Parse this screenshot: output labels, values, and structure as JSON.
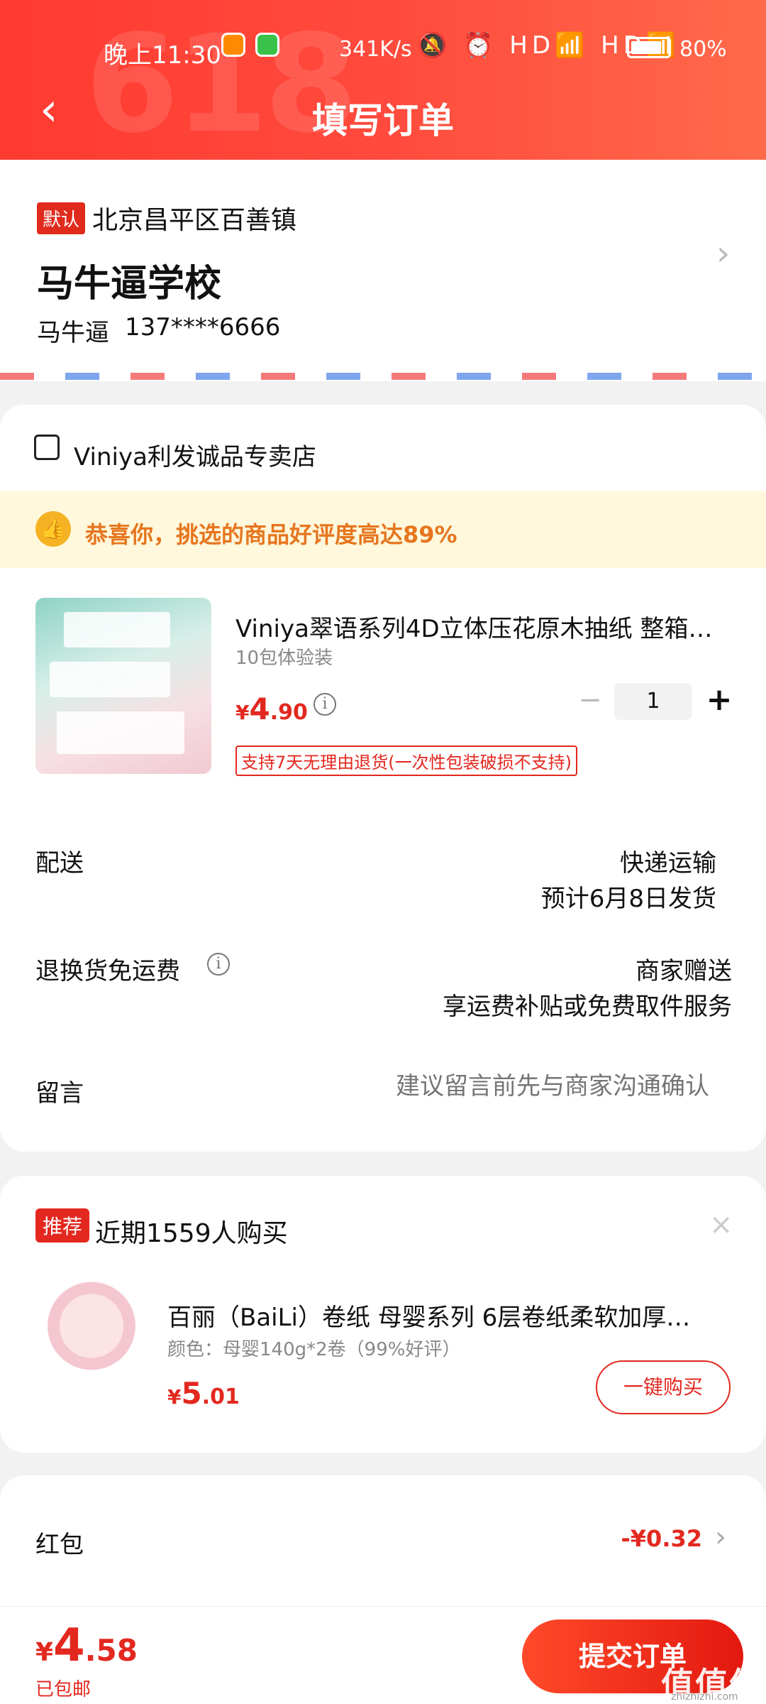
{
  "status_bar": {
    "time": "晚上11:30",
    "speed": "341K/s",
    "icons": "🔕 ⏰ HD📶 HD📶 ",
    "battery": "80%"
  },
  "header": {
    "title": "填写订单",
    "back": "‹"
  },
  "address": {
    "tag": "默认",
    "region": "北京昌平区百善镇",
    "detail": "马牛逼学校",
    "name": "马牛逼",
    "phone": "137****6666",
    "arrow": "›"
  },
  "store": {
    "name": "Viniya利发诚品专卖店",
    "praise": "恭喜你，挑选的商品好评度高达89%",
    "praise_icon": "👍",
    "product": {
      "title": "Viniya翠语系列4D立体压花原木抽纸 整箱…",
      "spec": "10包体验装",
      "price_currency": "¥",
      "price_int": "4",
      "price_dec": ".90",
      "info": "i",
      "qty_minus": "−",
      "quantity": "1",
      "qty_plus": "+",
      "return_policy": "支持7天无理由退货(一次性包装破损不支持)"
    },
    "delivery": {
      "label": "配送",
      "method": "快递运输",
      "eta": "预计6月8日发货"
    },
    "return_fee": {
      "label": "退换货免运费",
      "info": "i",
      "value": "商家赠送",
      "desc": "享运费补贴或免费取件服务"
    },
    "message": {
      "label": "留言",
      "placeholder": "建议留言前先与商家沟通确认"
    }
  },
  "recommend": {
    "tag": "推荐",
    "heading": "近期1559人购买",
    "close": "×",
    "title": "百丽（BaiLi）卷纸 母婴系列 6层卷纸柔软加厚…",
    "spec": "颜色：母婴140g*2卷（99%好评）",
    "price_currency": "¥",
    "price_int": "5",
    "price_dec": ".01",
    "buy_label": "一键购买"
  },
  "red_packet": {
    "label": "红包",
    "value": "-¥0.32",
    "arrow": "›"
  },
  "footer": {
    "total_currency": "¥",
    "total_int": "4",
    "total_dec": ".58",
    "shipping_note": "已包邮",
    "submit_label": "提交订单",
    "watermark": "值值值",
    "watermark_sub": "zhizhizhi.com"
  }
}
